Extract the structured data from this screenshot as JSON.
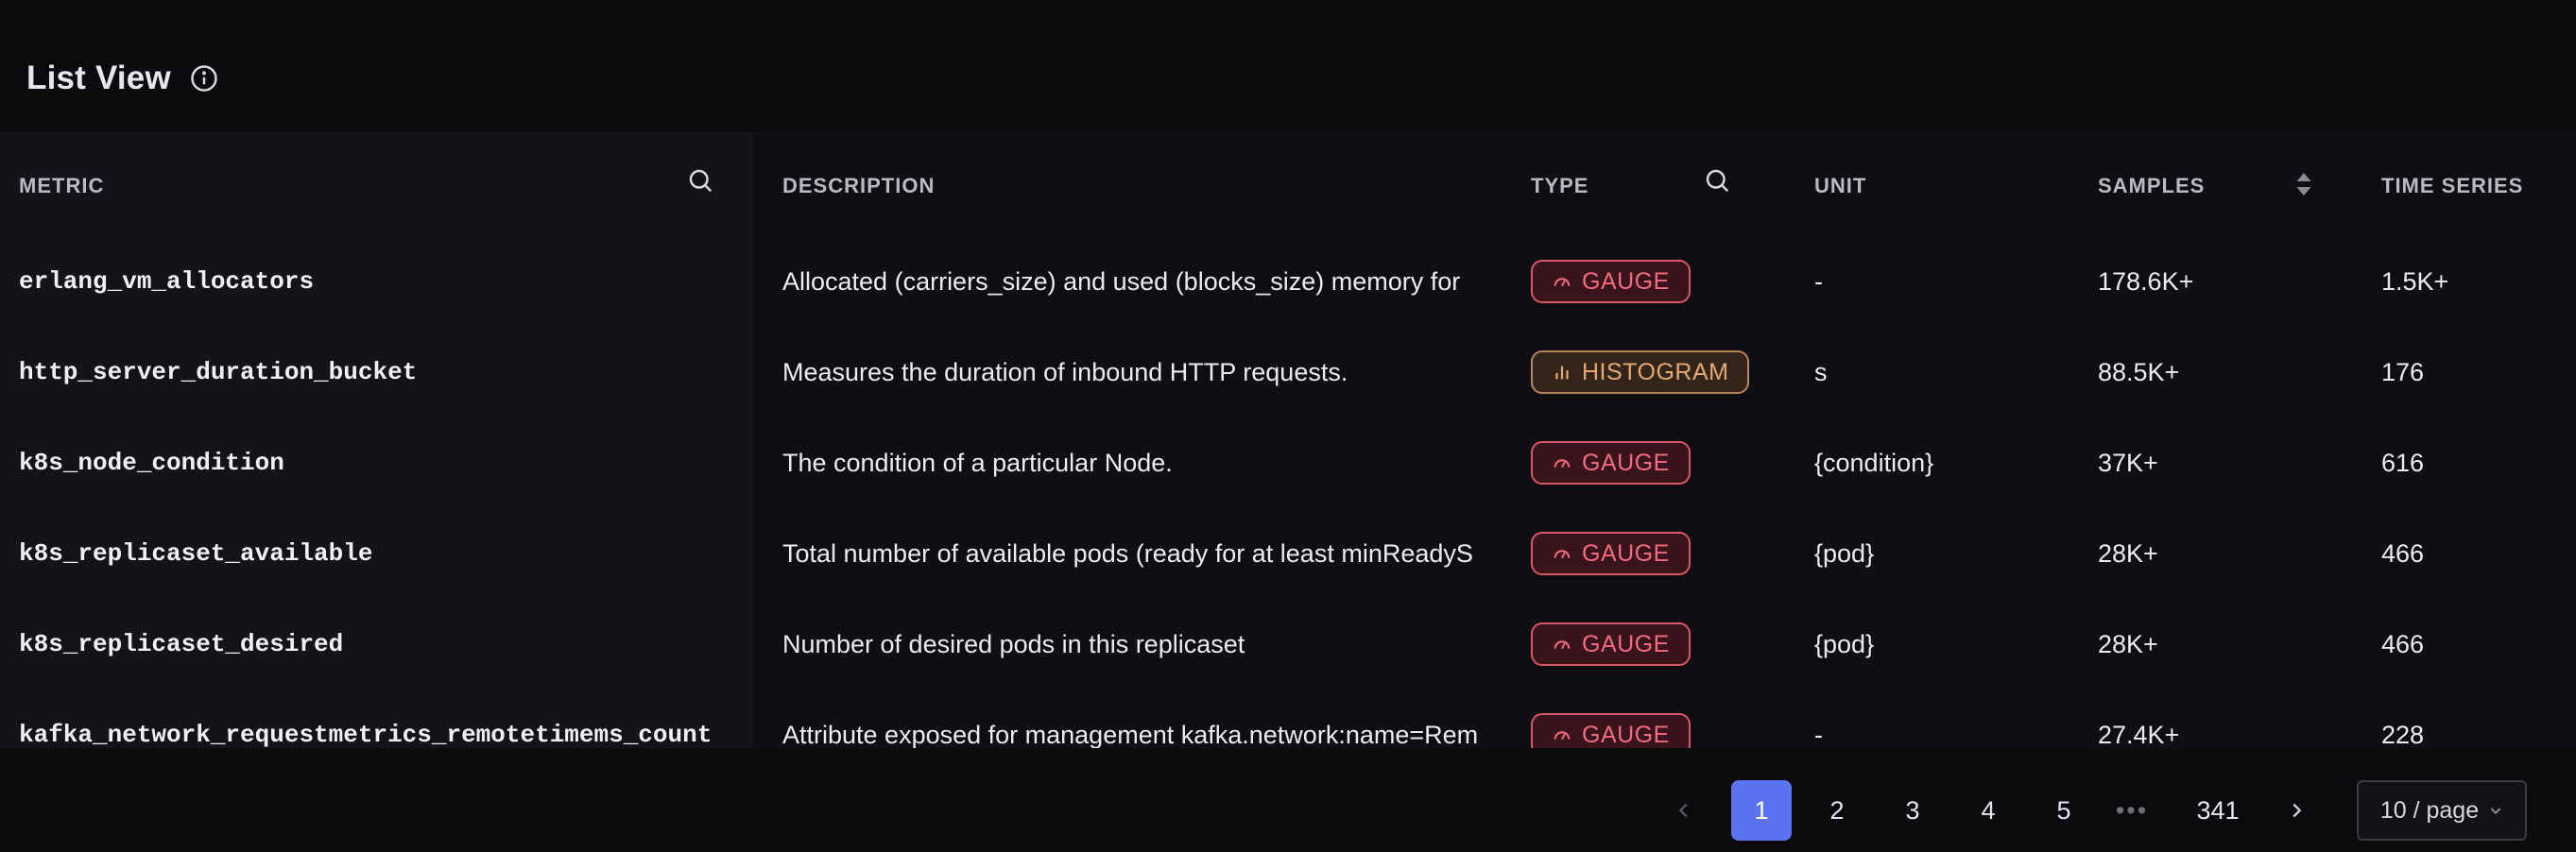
{
  "header": {
    "title": "List View",
    "info_icon": "info-circle-icon"
  },
  "table": {
    "columns": {
      "metric": "METRIC",
      "description": "DESCRIPTION",
      "type": "TYPE",
      "unit": "UNIT",
      "samples": "SAMPLES",
      "time_series": "TIME SERIES"
    },
    "rows": [
      {
        "metric": "erlang_vm_allocators",
        "description": "Allocated (carriers_size) and used (blocks_size) memory for",
        "type": "GAUGE",
        "type_kind": "gauge",
        "unit": "-",
        "samples": "178.6K+",
        "time_series": "1.5K+"
      },
      {
        "metric": "http_server_duration_bucket",
        "description": "Measures the duration of inbound HTTP requests.",
        "type": "HISTOGRAM",
        "type_kind": "histogram",
        "unit": "s",
        "samples": "88.5K+",
        "time_series": "176"
      },
      {
        "metric": "k8s_node_condition",
        "description": "The condition of a particular Node.",
        "type": "GAUGE",
        "type_kind": "gauge",
        "unit": "{condition}",
        "samples": "37K+",
        "time_series": "616"
      },
      {
        "metric": "k8s_replicaset_available",
        "description": "Total number of available pods (ready for at least minReadyS",
        "type": "GAUGE",
        "type_kind": "gauge",
        "unit": "{pod}",
        "samples": "28K+",
        "time_series": "466"
      },
      {
        "metric": "k8s_replicaset_desired",
        "description": "Number of desired pods in this replicaset",
        "type": "GAUGE",
        "type_kind": "gauge",
        "unit": "{pod}",
        "samples": "28K+",
        "time_series": "466"
      },
      {
        "metric": "kafka_network_requestmetrics_remotetimems_count",
        "description": "Attribute exposed for management kafka.network:name=Rem",
        "type": "GAUGE",
        "type_kind": "gauge",
        "unit": "-",
        "samples": "27.4K+",
        "time_series": "228"
      }
    ]
  },
  "pagination": {
    "pages": [
      "1",
      "2",
      "3",
      "4",
      "5"
    ],
    "active": "1",
    "ellipsis": "•••",
    "last": "341",
    "page_size": "10 / page"
  },
  "colors": {
    "accent": "#5b73f0",
    "gauge": "#f16b7e",
    "histogram": "#e4aa72"
  }
}
